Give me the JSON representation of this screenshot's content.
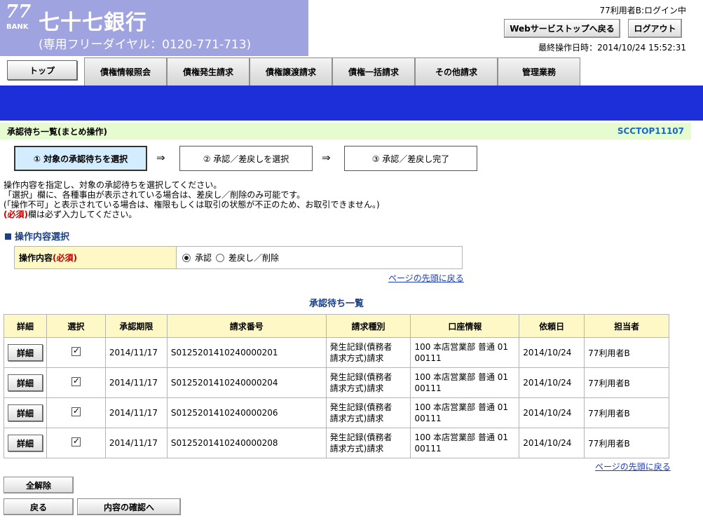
{
  "brand": {
    "logo_number": "77",
    "logo_text": "BANK",
    "bank_name": "七十七銀行",
    "dial": "(専用フリーダイヤル：0120-771-713)"
  },
  "header": {
    "user_status": "77利用者B:ログイン中",
    "web_service_top_label": "Webサービストップへ戻る",
    "logout_label": "ログアウト",
    "last_operation": "最終操作日時：2014/10/24 15:52:31"
  },
  "tabs": {
    "top_label": "トップ",
    "items": [
      "債権情報照会",
      "債権発生請求",
      "債権譲渡請求",
      "債権一括請求",
      "その他請求",
      "管理業務"
    ]
  },
  "page": {
    "title": "承認待ち一覧(まとめ操作)",
    "screen_code": "SCCTOP11107"
  },
  "steps": {
    "step1": "① 対象の承認待ちを選択",
    "step2": "② 承認／差戻しを選択",
    "step3": "③ 承認／差戻し完了",
    "arrow": "⇒"
  },
  "instructions": {
    "line1": "操作内容を指定し、対象の承認待ちを選択してください。",
    "line2": "「選択」欄に、各種事由が表示されている場合は、差戻し／削除のみ可能です。",
    "line3": "(「操作不可」と表示されている場合は、権限もしくは取引の状態が不正のため、お取引できません。)",
    "req_label": "(必須)",
    "line4_rest": "欄は必ず入力してください。"
  },
  "operation_section": {
    "heading": "操作内容選択",
    "label": "操作内容",
    "req": "(必須)",
    "option_approve": "承認",
    "option_return": "差戻し／削除",
    "selected": "承認"
  },
  "links": {
    "page_top": "ページの先頭に戻る"
  },
  "list": {
    "title": "承認待ち一覧",
    "headers": [
      "詳細",
      "選択",
      "承認期限",
      "請求番号",
      "請求種別",
      "口座情報",
      "依頼日",
      "担当者"
    ],
    "rows": [
      {
        "detail": "詳細",
        "checked": true,
        "deadline": "2014/11/17",
        "request_no": "S0125201410240000201",
        "type_l1": "発生記録(債務者",
        "type_l2": "請求方式)請求",
        "acct_l1": "100 本店営業部 普通 01",
        "acct_l2": "00111",
        "date": "2014/10/24",
        "person": "77利用者B"
      },
      {
        "detail": "詳細",
        "checked": true,
        "deadline": "2014/11/17",
        "request_no": "S0125201410240000204",
        "type_l1": "発生記録(債務者",
        "type_l2": "請求方式)請求",
        "acct_l1": "100 本店営業部 普通 01",
        "acct_l2": "00111",
        "date": "2014/10/24",
        "person": "77利用者B"
      },
      {
        "detail": "詳細",
        "checked": true,
        "deadline": "2014/11/17",
        "request_no": "S0125201410240000206",
        "type_l1": "発生記録(債務者",
        "type_l2": "請求方式)請求",
        "acct_l1": "100 本店営業部 普通 01",
        "acct_l2": "00111",
        "date": "2014/10/24",
        "person": "77利用者B"
      },
      {
        "detail": "詳細",
        "checked": true,
        "deadline": "2014/11/17",
        "request_no": "S0125201410240000208",
        "type_l1": "発生記録(債務者",
        "type_l2": "請求方式)請求",
        "acct_l1": "100 本店営業部 普通 01",
        "acct_l2": "00111",
        "date": "2014/10/24",
        "person": "77利用者B"
      }
    ]
  },
  "footer_buttons": {
    "clear_all": "全解除",
    "back": "戻る",
    "confirm": "内容の確認へ"
  }
}
